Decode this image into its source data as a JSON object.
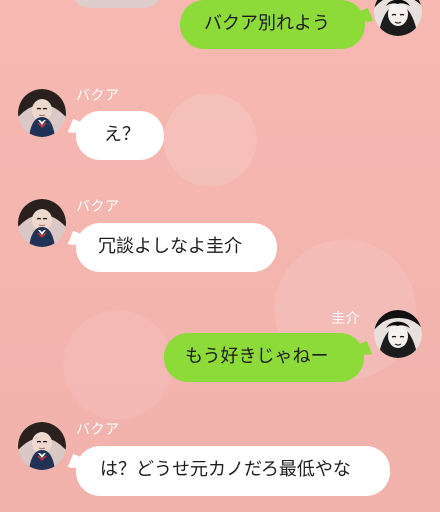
{
  "messages": [
    {
      "sender": "user",
      "text": "バクア別れよう"
    },
    {
      "sender": "contact",
      "name": "バクア",
      "text": "え？"
    },
    {
      "sender": "contact",
      "name": "バクア",
      "text": "冗談よしなよ圭介"
    },
    {
      "sender": "user",
      "name": "圭介",
      "text": "もう好きじゃねー"
    },
    {
      "sender": "contact",
      "name": "バクア",
      "text": "は？どうせ元カノだろ最低やな"
    }
  ]
}
